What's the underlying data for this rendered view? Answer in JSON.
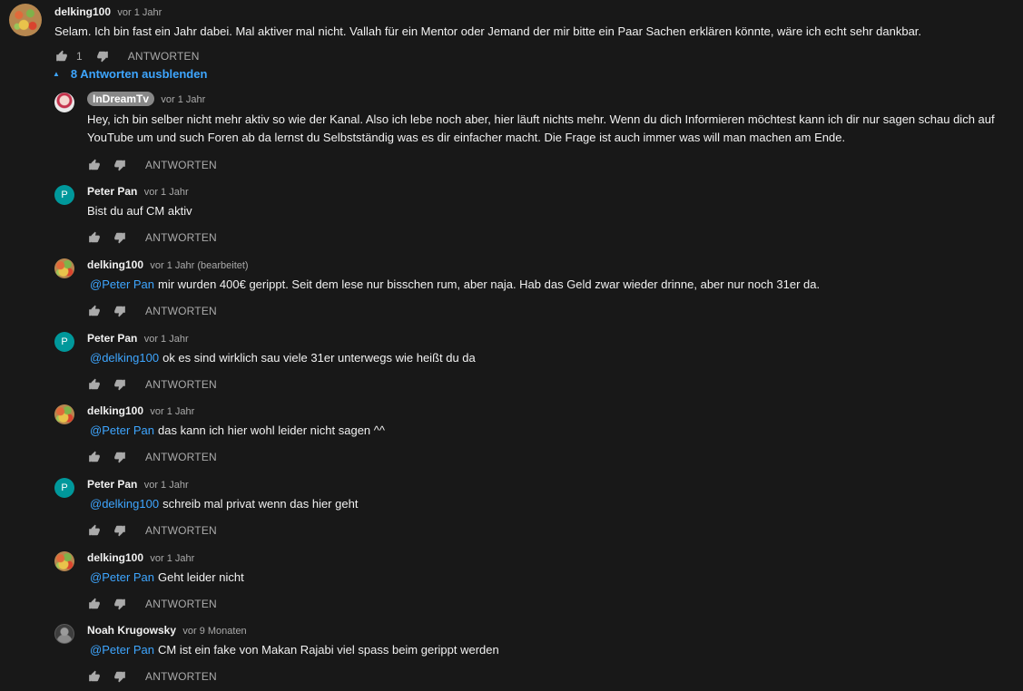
{
  "top_comment": {
    "author": "delking100",
    "time": "vor 1 Jahr",
    "text": "Selam. Ich bin fast ein Jahr dabei. Mal aktiver mal nicht. Vallah für ein Mentor oder Jemand der mir bitte ein Paar Sachen erklären könnte, wäre ich echt sehr dankbar.",
    "likes": "1",
    "reply_label": "ANTWORTEN"
  },
  "toggle_label": "8 Antworten ausblenden",
  "replies": [
    {
      "author": "InDreamTv",
      "time": "vor 1 Jahr",
      "text": "Hey, ich bin selber nicht mehr aktiv so wie der Kanal. Also ich lebe noch aber, hier läuft nichts mehr. Wenn du dich Informieren möchtest kann ich dir nur sagen schau dich auf YouTube um und such Foren ab da lernst du Selbstständig was es dir einfacher macht. Die Frage ist auch immer was  will man machen am Ende.",
      "reply_label": "ANTWORTEN"
    },
    {
      "author": "Peter Pan",
      "avatar_letter": "P",
      "time": "vor 1 Jahr",
      "text": "Bist du auf CM aktiv",
      "reply_label": "ANTWORTEN"
    },
    {
      "author": "delking100",
      "time": "vor 1 Jahr (bearbeitet)",
      "mention": "@Peter Pan",
      "text": "mir wurden 400€ gerippt. Seit dem lese nur bisschen rum, aber naja. Hab das Geld zwar wieder drinne, aber nur noch 31er da.",
      "reply_label": "ANTWORTEN"
    },
    {
      "author": "Peter Pan",
      "avatar_letter": "P",
      "time": "vor 1 Jahr",
      "mention": "@delking100",
      "text": "ok es sind wirklich sau viele 31er unterwegs wie heißt du da",
      "reply_label": "ANTWORTEN"
    },
    {
      "author": "delking100",
      "time": "vor 1 Jahr",
      "mention": "@Peter Pan",
      "text": "das kann ich hier wohl leider nicht sagen ^^",
      "reply_label": "ANTWORTEN"
    },
    {
      "author": "Peter Pan",
      "avatar_letter": "P",
      "time": "vor 1 Jahr",
      "mention": "@delking100",
      "text": "schreib mal privat wenn das hier geht",
      "reply_label": "ANTWORTEN"
    },
    {
      "author": "delking100",
      "time": "vor 1 Jahr",
      "mention": "@Peter Pan",
      "text": "Geht leider nicht",
      "reply_label": "ANTWORTEN"
    },
    {
      "author": "Noah Krugowsky",
      "time": "vor 9 Monaten",
      "mention": "@Peter Pan",
      "text": "CM ist ein fake von Makan Rajabi viel spass beim gerippt werden",
      "reply_label": "ANTWORTEN"
    }
  ],
  "icons": {
    "like": "thumbs-up-icon",
    "dislike": "thumbs-down-icon",
    "toggle": "caret-up-icon"
  },
  "colors": {
    "background": "#181818",
    "text": "#f1f1f1",
    "secondary": "#aaaaaa",
    "link": "#3ea6ff",
    "avatar_teal": "#00989b"
  }
}
